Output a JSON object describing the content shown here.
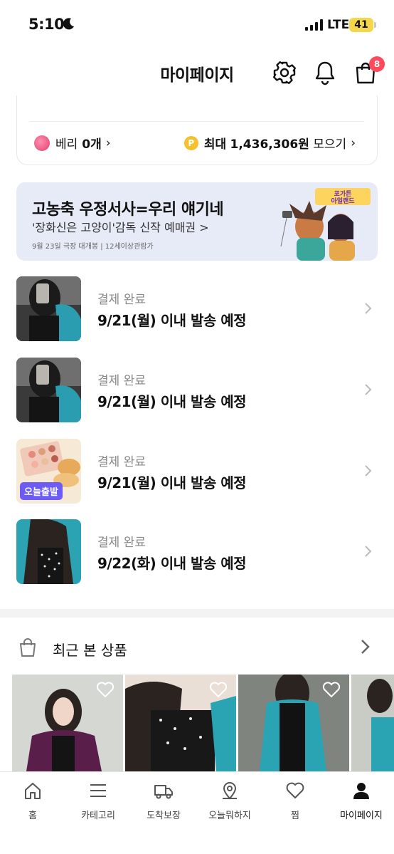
{
  "status_bar": {
    "time": "5:10",
    "network": "LTE",
    "battery": "41"
  },
  "header": {
    "title": "마이페이지",
    "cart_badge": "8"
  },
  "benefits": {
    "berry_label": "베리",
    "berry_count": "0개",
    "points_label": "최대",
    "points_value": "1,436,306원",
    "points_action": "모으기"
  },
  "banner": {
    "title": "고농축 우정서사=우리 얘기네",
    "subtitle": "'장화신은 고양이'감독 신작 예매권 >",
    "note": "9월 23일 극장 대개봉 | 12세이상관람가",
    "logo_text": "포가튼 아일랜드"
  },
  "orders": [
    {
      "status": "결제 완료",
      "shipping": "9/21(월) 이내 발송 예정",
      "badge": ""
    },
    {
      "status": "결제 완료",
      "shipping": "9/21(월) 이내 발송 예정",
      "badge": ""
    },
    {
      "status": "결제 완료",
      "shipping": "9/21(월) 이내 발송 예정",
      "badge": "오늘출발"
    },
    {
      "status": "결제 완료",
      "shipping": "9/22(화) 이내 발송 예정",
      "badge": ""
    }
  ],
  "recent": {
    "title": "최근 본 상품"
  },
  "tabs": [
    {
      "label": "홈",
      "icon": "home-icon"
    },
    {
      "label": "카테고리",
      "icon": "menu-icon"
    },
    {
      "label": "도착보장",
      "icon": "truck-icon"
    },
    {
      "label": "오늘뭐하지",
      "icon": "map-pin-icon"
    },
    {
      "label": "찜",
      "icon": "heart-icon"
    },
    {
      "label": "마이페이지",
      "icon": "person-icon",
      "active": true
    }
  ],
  "colors": {
    "accent_badge": "#ff4a5c",
    "point": "#f4c02c",
    "today_badge": "#6c5cf5",
    "banner_bg": "#e7ebf7"
  }
}
